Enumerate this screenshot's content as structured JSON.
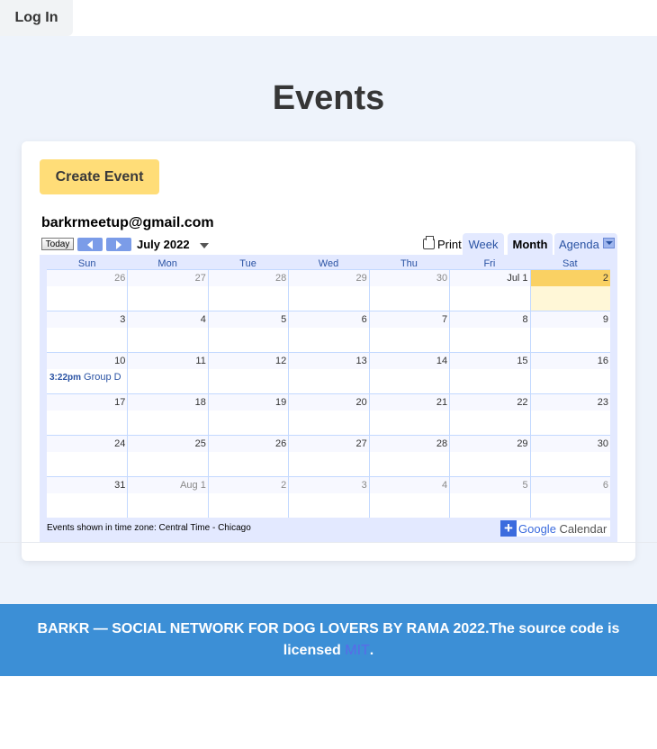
{
  "header": {
    "login_label": "Log In"
  },
  "page": {
    "title": "Events"
  },
  "card": {
    "create_label": "Create Event"
  },
  "calendar": {
    "owner": "barkrmeetup@gmail.com",
    "today_label": "Today",
    "month_label": "July 2022",
    "print_label": "Print",
    "views": {
      "week": "Week",
      "month": "Month",
      "agenda": "Agenda"
    },
    "weekdays": [
      "Sun",
      "Mon",
      "Tue",
      "Wed",
      "Thu",
      "Fri",
      "Sat"
    ],
    "weeks": [
      [
        "26",
        "27",
        "28",
        "29",
        "30",
        "Jul 1",
        "2"
      ],
      [
        "3",
        "4",
        "5",
        "6",
        "7",
        "8",
        "9"
      ],
      [
        "10",
        "11",
        "12",
        "13",
        "14",
        "15",
        "16"
      ],
      [
        "17",
        "18",
        "19",
        "20",
        "21",
        "22",
        "23"
      ],
      [
        "24",
        "25",
        "26",
        "27",
        "28",
        "29",
        "30"
      ],
      [
        "31",
        "Aug 1",
        "2",
        "3",
        "4",
        "5",
        "6"
      ]
    ],
    "event": {
      "time": "3:22pm",
      "title": "Group D"
    },
    "timezone_note": "Events shown in time zone: Central Time - Chicago",
    "badge": {
      "plus": "+",
      "google": "Google",
      "calendar": "Calendar"
    }
  },
  "footer": {
    "text": "BARKR — SOCIAL NETWORK FOR DOG LOVERS BY RAMA 2022.The source code is licensed ",
    "link": "MIT",
    "end": "."
  },
  "colors": {
    "accent": "#ffdd78",
    "footer_bg": "#3c8fd6",
    "today_bg": "#fad163",
    "page_bg": "#eef3fb"
  }
}
